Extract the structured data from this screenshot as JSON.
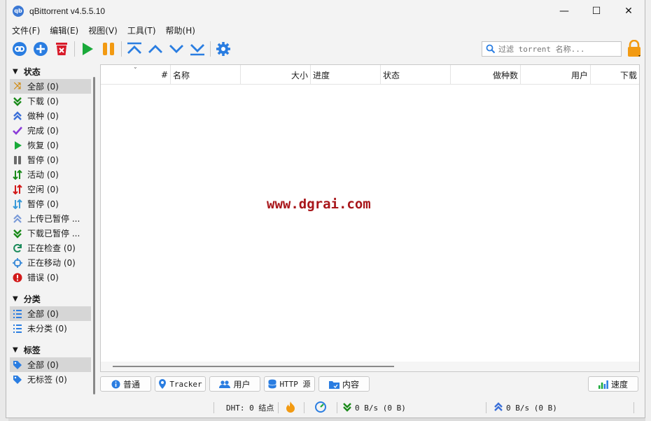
{
  "window": {
    "title": "qBittorrent v4.5.5.10",
    "app_icon_text": "qb"
  },
  "window_controls": {
    "minimize": "—",
    "maximize": "☐",
    "close": "✕"
  },
  "menu": [
    "文件(F)",
    "编辑(E)",
    "视图(V)",
    "工具(T)",
    "帮助(H)"
  ],
  "toolbar": {
    "buttons": [
      "link-icon",
      "add-icon",
      "delete-icon",
      "play-icon",
      "pause-icon",
      "move-top-icon",
      "move-up-icon",
      "move-down-icon",
      "move-bottom-icon",
      "gear-icon"
    ],
    "search_placeholder": "过滤 torrent 名称...",
    "accent": "#2a7de1"
  },
  "sidebar": {
    "status_header": "状态",
    "status_items": [
      {
        "label": "全部 (0)",
        "icon": "shuffle-icon",
        "color": "#d08a12"
      },
      {
        "label": "下载 (0)",
        "icon": "download-icon",
        "color": "#1a8a1a"
      },
      {
        "label": "做种 (0)",
        "icon": "seed-icon",
        "color": "#3a6fd8"
      },
      {
        "label": "完成 (0)",
        "icon": "check-icon",
        "color": "#8a3ad8"
      },
      {
        "label": "恢复 (0)",
        "icon": "play-icon",
        "color": "#1aaa3a"
      },
      {
        "label": "暂停 (0)",
        "icon": "pause-icon",
        "color": "#6a6a6a"
      },
      {
        "label": "活动 (0)",
        "icon": "active-icon",
        "color": "#1a8a1a"
      },
      {
        "label": "空闲 (0)",
        "icon": "inactive-icon",
        "color": "#d21a1a"
      },
      {
        "label": "暂停 (0)",
        "icon": "stalled-icon",
        "color": "#3a9ad8"
      },
      {
        "label": "上传已暂停 ...",
        "icon": "upload-stalled-icon",
        "color": "#3a6fd8"
      },
      {
        "label": "下载已暂停 ...",
        "icon": "download-stalled-icon",
        "color": "#1a8a1a"
      },
      {
        "label": "正在检查 (0)",
        "icon": "refresh-icon",
        "color": "#1a8a5a"
      },
      {
        "label": "正在移动 (0)",
        "icon": "target-icon",
        "color": "#3a8ad8"
      },
      {
        "label": "错误 (0)",
        "icon": "error-icon",
        "color": "#d21a1a"
      }
    ],
    "category_header": "分类",
    "category_items": [
      "全部 (0)",
      "未分类 (0)"
    ],
    "tag_header": "标签",
    "tag_items": [
      "全部 (0)",
      "无标签 (0)"
    ]
  },
  "table": {
    "columns": [
      "#",
      "名称",
      "大小",
      "进度",
      "状态",
      "做种数",
      "用户",
      "下载"
    ],
    "rows": []
  },
  "watermark": "www.dgrai.com",
  "bottom_tabs": [
    "普通",
    "Tracker",
    "用户",
    "HTTP 源",
    "内容"
  ],
  "speed_button": "速度",
  "statusbar": {
    "dht": "DHT: 0 结点",
    "download_speed": "0 B/s (0 B)",
    "upload_speed": "0 B/s (0 B)"
  }
}
